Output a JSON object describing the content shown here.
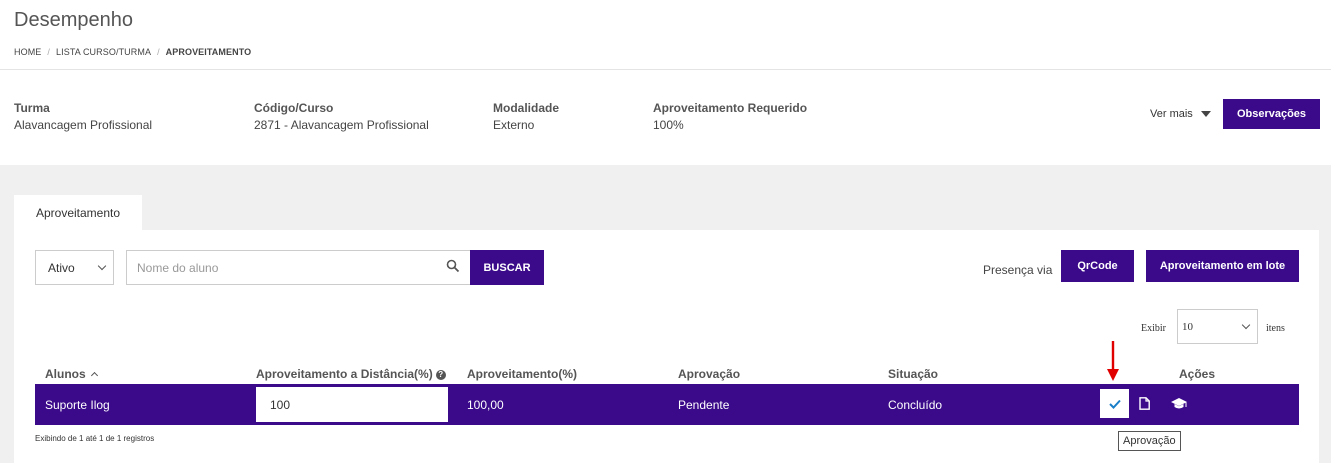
{
  "header": {
    "title": "Desempenho",
    "breadcrumb": [
      "HOME",
      "LISTA CURSO/TURMA",
      "APROVEITAMENTO"
    ]
  },
  "info": {
    "turma_label": "Turma",
    "turma_value": "Alavancagem Profissional",
    "codigo_label": "Código/Curso",
    "codigo_value": "2871 - Alavancagem Profissional",
    "modalidade_label": "Modalidade",
    "modalidade_value": "Externo",
    "aproveitamento_label": "Aproveitamento Requerido",
    "aproveitamento_value": "100%",
    "ver_mais": "Ver mais",
    "observacoes": "Observações"
  },
  "tab": {
    "label": "Aproveitamento"
  },
  "filters": {
    "status_value": "Ativo",
    "search_placeholder": "Nome do aluno",
    "buscar": "BUSCAR",
    "presenca_label": "Presença via",
    "qrcode": "QrCode",
    "lote": "Aproveitamento em lote",
    "exibir": "Exibir",
    "itens_value": "10",
    "itens": "itens"
  },
  "table": {
    "columns": [
      "Alunos",
      "Aproveitamento a Distância(%)",
      "Aproveitamento(%)",
      "Aprovação",
      "Situação",
      "Ações"
    ],
    "rows": [
      {
        "aluno": "Suporte Ilog",
        "distancia": "100",
        "aproveitamento": "100,00",
        "aprovacao": "Pendente",
        "situacao": "Concluído"
      }
    ],
    "footer": "Exibindo de 1 até 1 de 1 registros"
  },
  "tooltip": "Aprovação",
  "colors": {
    "primary": "#3a0a8a",
    "arrow": "#e00000",
    "check": "#1a7fc8"
  },
  "icons": [
    "search-icon",
    "check-icon",
    "document-icon",
    "graduation-cap-icon",
    "help-icon",
    "caret-down-icon",
    "red-arrow-icon"
  ]
}
